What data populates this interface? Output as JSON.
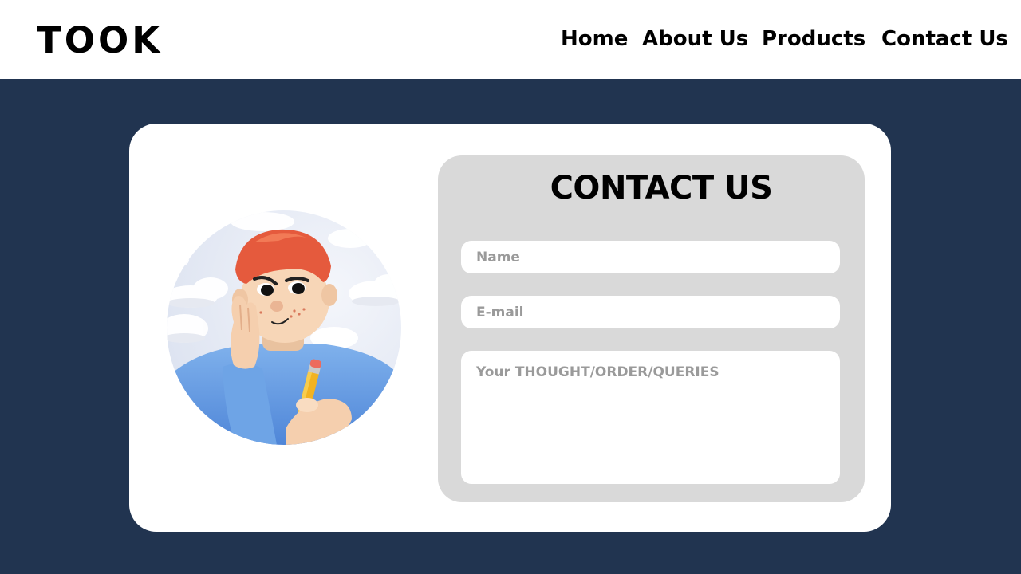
{
  "header": {
    "logo": "TOOK",
    "nav": {
      "home": "Home",
      "about": "About Us",
      "products": "Products",
      "contact": "Contact Us"
    }
  },
  "contact_form": {
    "title": "CONTACT US",
    "name_placeholder": "Name",
    "email_placeholder": "E-mail",
    "message_placeholder": "Your THOUGHT/ORDER/QUERIES",
    "name_value": "",
    "email_value": "",
    "message_value": ""
  },
  "illustration": {
    "icon": "person-thinking-with-pencil-illustration"
  },
  "colors": {
    "page_background": "#213450",
    "header_background": "#ffffff",
    "card_background": "#ffffff",
    "form_panel_background": "#d9d9d9",
    "placeholder_text": "#9a9a9a"
  }
}
